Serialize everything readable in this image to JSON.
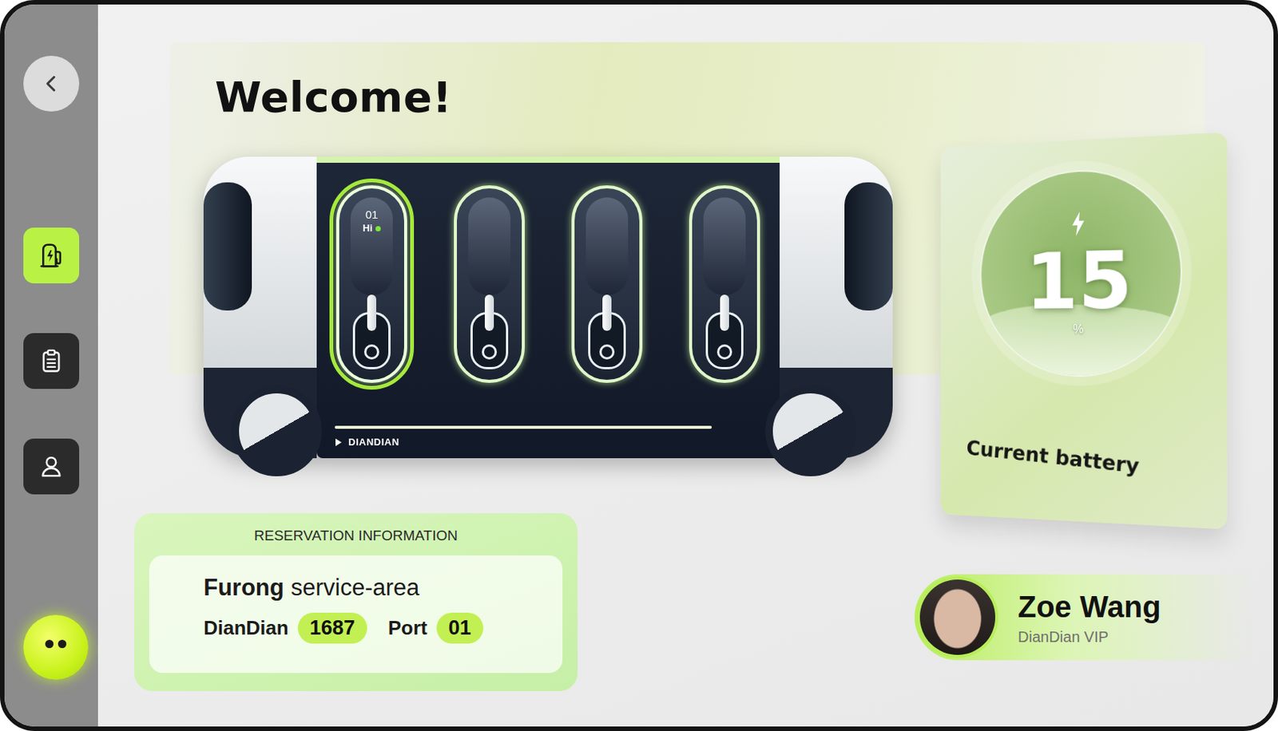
{
  "sidebar": {
    "items": [
      {
        "kind": "charger",
        "selected": true
      },
      {
        "kind": "orders",
        "selected": false
      },
      {
        "kind": "profile",
        "selected": false
      }
    ]
  },
  "welcome": {
    "title": "Welcome!"
  },
  "station": {
    "brand": "DIANDIAN",
    "ports": [
      {
        "number": "01",
        "greeting": "Hi",
        "online": true,
        "selected": true
      },
      {
        "selected": false
      },
      {
        "selected": false
      },
      {
        "selected": false
      }
    ]
  },
  "battery": {
    "value": "15",
    "unit": "%",
    "label": "Current battery",
    "level": 0.15
  },
  "reservation": {
    "heading": "RESERVATION INFORMATION",
    "place_bold": "Furong",
    "place_rest": "service-area",
    "station_label": "DianDian",
    "station_number": "1687",
    "port_label": "Port",
    "port_number": "01"
  },
  "user": {
    "name": "Zoe Wang",
    "tier": "DianDian VIP"
  }
}
